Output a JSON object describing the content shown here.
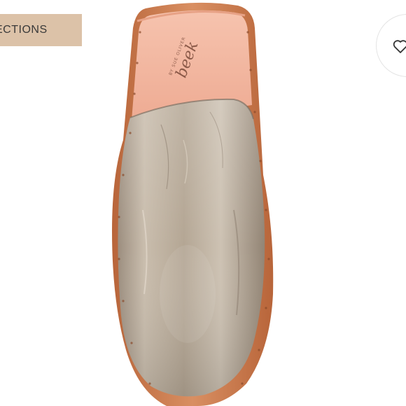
{
  "listing": {
    "collections_badge": "ECTIONS",
    "brand_logo_text": "beek",
    "brand_logo_subtext": "BY SUE OLIVER"
  },
  "colors": {
    "badge_bg": "#dcc2a8",
    "leather_metallic": "#b9ab99",
    "insole_pink": "#f3b8a0",
    "sole_copper": "#c9794c"
  },
  "icons": {
    "like": "heart-outline-icon"
  }
}
